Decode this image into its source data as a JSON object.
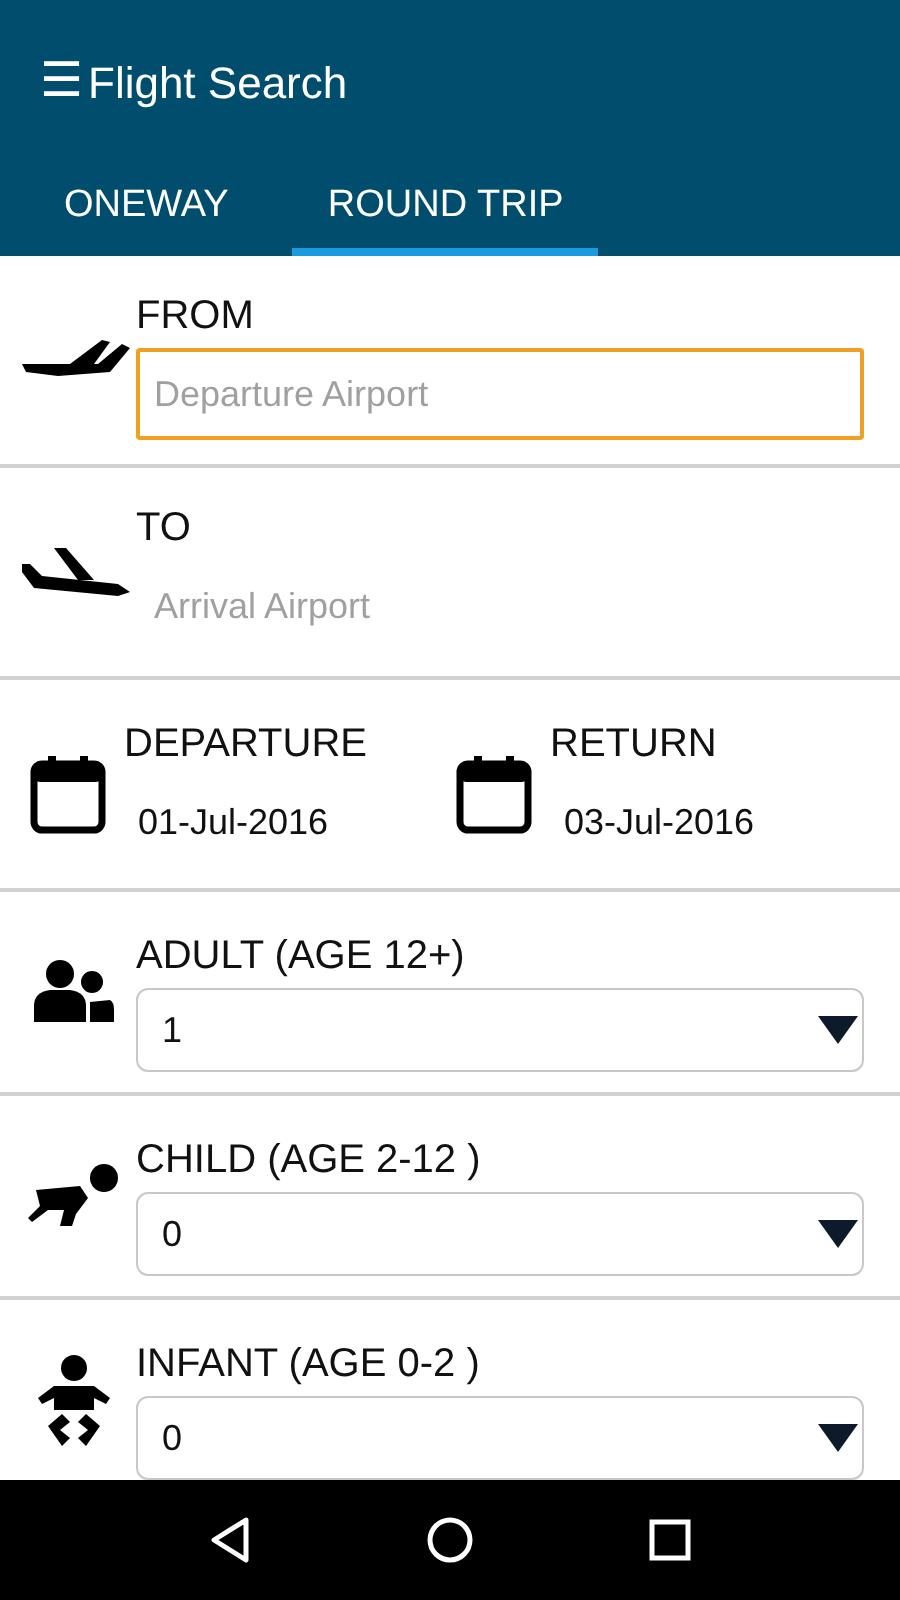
{
  "app_bar": {
    "menu_glyph": "☰",
    "title": "Flight Search"
  },
  "tabs": [
    {
      "label": "ONEWAY",
      "selected": false
    },
    {
      "label": "ROUND TRIP",
      "selected": true
    }
  ],
  "sections": [
    {
      "kind": "airport",
      "label": "FROM",
      "placeholder": "Departure Airport",
      "focused": true
    },
    {
      "kind": "airport",
      "label": "TO",
      "placeholder": "Arrival Airport",
      "focused": false
    },
    {
      "kind": "dates",
      "dates": [
        {
          "label": "DEPARTURE",
          "value": "01-Jul-2016"
        },
        {
          "label": "RETURN",
          "value": "03-Jul-2016"
        }
      ]
    },
    {
      "kind": "count",
      "label": "ADULT (AGE 12+)",
      "value": "1"
    },
    {
      "kind": "count",
      "label": "CHILD (AGE 2-12 )",
      "value": "0"
    },
    {
      "kind": "count",
      "label": "INFANT (AGE 0-2 )",
      "value": "0"
    }
  ]
}
